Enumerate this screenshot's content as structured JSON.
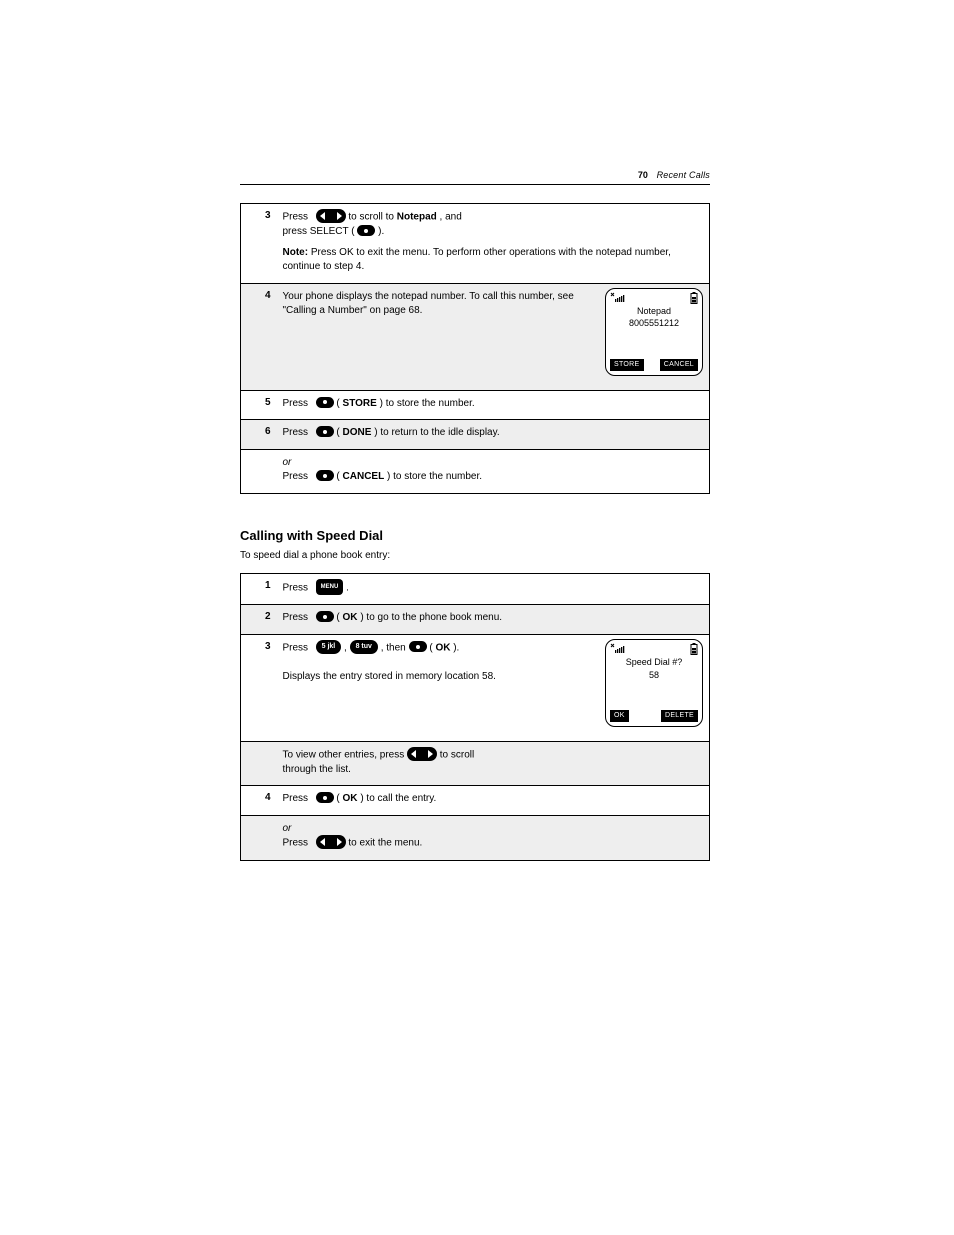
{
  "header": {
    "page_number": "70",
    "running_title": "Recent Calls"
  },
  "labels": {
    "press": "Press",
    "or": "or",
    "ok": "OK",
    "menu": "MENU",
    "store": "STORE",
    "done": "DONE",
    "cancel": "CANCEL"
  },
  "keys": {
    "digit5": "5 jkl",
    "digit8": "8 tuv"
  },
  "table1": {
    "rows": [
      {
        "n": "3",
        "frag_a": " to scroll to ",
        "bold_a": "Notepad",
        "frag_b": ", and",
        "line2_a": "press SELECT (",
        "line2_b": ").",
        "note_label": "Note: ",
        "note_text": "Press OK to exit the menu. To perform other operations with the notepad number, continue to step 4."
      },
      {
        "n": "4",
        "text_before": "Your phone displays the notepad number. To call this number, see \"Calling a Number\" on page 68.",
        "lcd": {
          "line1": "Notepad",
          "line2": "8005551212",
          "soft_left": "STORE",
          "soft_right": "CANCEL"
        }
      },
      {
        "n": "5",
        "frag_a": " (",
        "frag_b": ") to store the number."
      },
      {
        "n": "6",
        "frag_a": " (",
        "frag_b": ") to return to the idle display."
      },
      {
        "n": "",
        "line2_a": " (",
        "line2_b": ") to store the number."
      }
    ]
  },
  "section": {
    "title": "Calling with Speed Dial",
    "lead": "To speed dial a phone book entry:"
  },
  "table2": {
    "head_press": "Press",
    "rows": [
      {
        "n": "1",
        "text": "."
      },
      {
        "n": "2",
        "frag_a": " (",
        "frag_b": ") to go to the phone book menu."
      },
      {
        "n": "3",
        "mid": ", ",
        "tail_a": ", then ",
        "tail_b": " (",
        "tail_c": ").",
        "body2": "Displays the entry stored in memory location 58.",
        "lcd": {
          "line1": "Speed Dial #?",
          "line2": "58",
          "soft_left": "OK",
          "soft_right": "DELETE"
        }
      },
      {
        "n": "",
        "body1_a": "To view other entries, press ",
        "body1_b": " to scroll",
        "body2": "through the list."
      },
      {
        "n": "4",
        "frag_a": " (",
        "frag_b": ") to call the entry."
      },
      {
        "n": "",
        "single": " to exit the menu."
      }
    ]
  }
}
